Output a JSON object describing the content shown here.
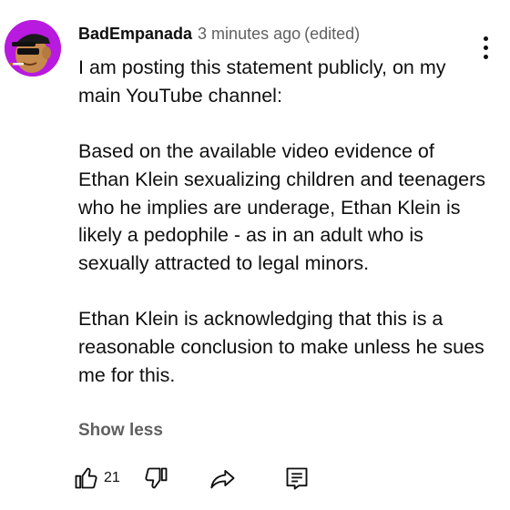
{
  "comment": {
    "author": "BadEmpanada",
    "timestamp": "3 minutes ago",
    "edited_label": "(edited)",
    "paragraph_1": "I am posting this statement publicly, on my main YouTube channel:",
    "paragraph_2": "Based on the available video evidence of Ethan Klein sexualizing children and teenagers who he implies are underage, Ethan Klein is likely a pedophile - as in an adult who is sexually attracted to legal minors.",
    "paragraph_3": "Ethan Klein is acknowledging that this is a reasonable conclusion to make unless he sues me for this.",
    "show_less_label": "Show less",
    "like_count": "21",
    "avatar_color": "#b81adf"
  },
  "icons": {
    "like": "thumbs-up-icon",
    "dislike": "thumbs-down-icon",
    "share": "share-icon",
    "reply": "reply-icon",
    "menu": "more-vertical-icon"
  }
}
